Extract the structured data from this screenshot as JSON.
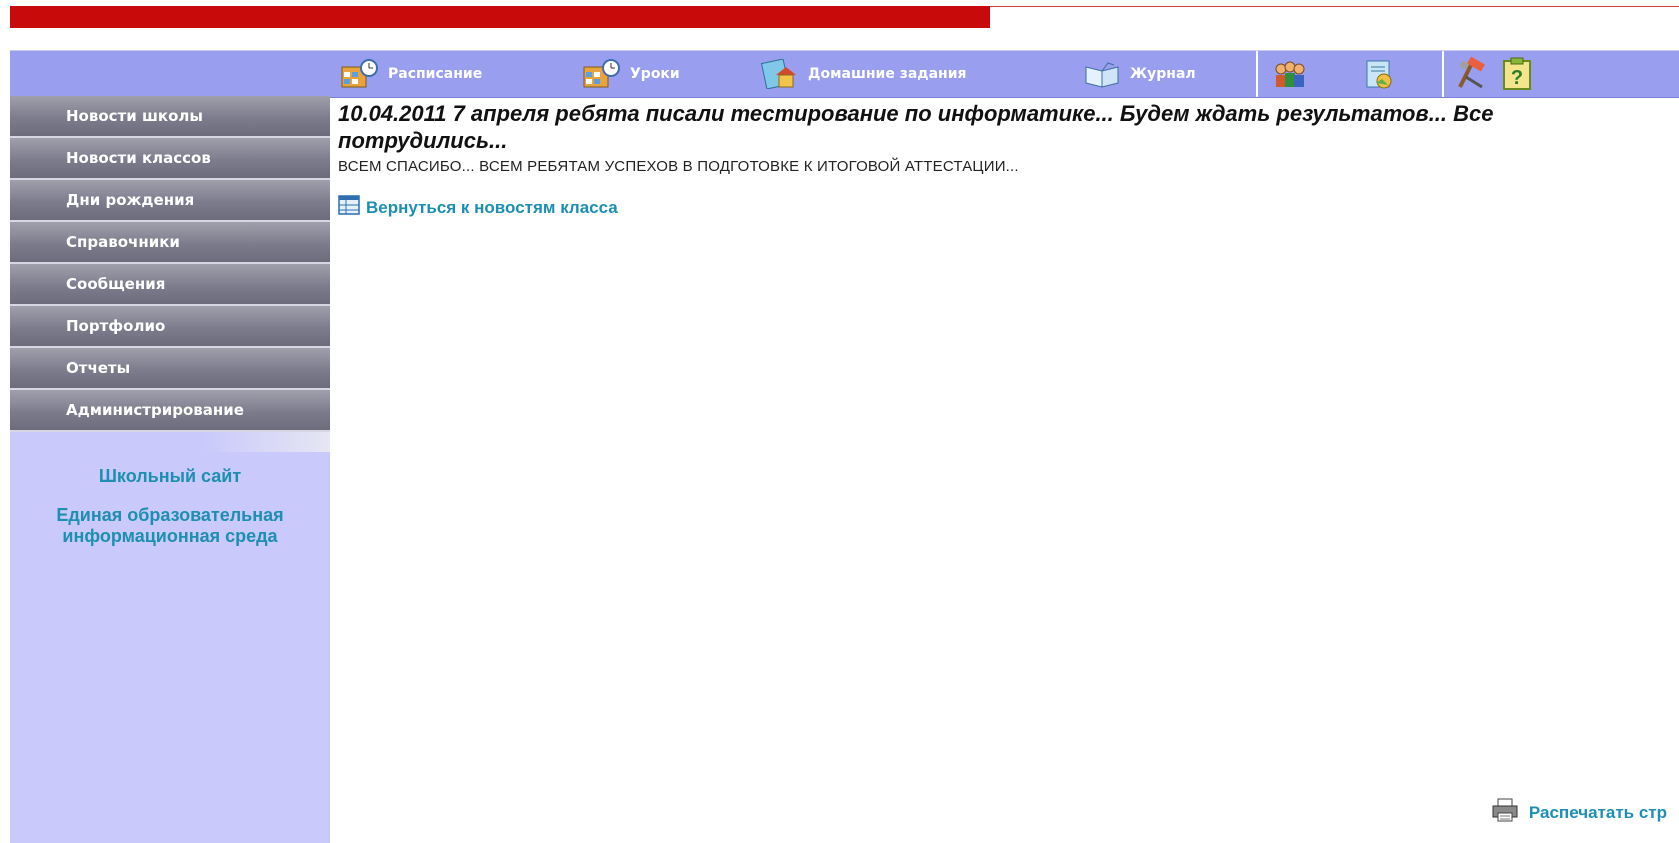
{
  "topnav": {
    "schedule_label": "Расписание",
    "lessons_label": "Уроки",
    "homework_label": "Домашние задания",
    "journal_label": "Журнал",
    "icons": [
      "people-icon",
      "certificate-icon",
      "tools-icon",
      "help-icon"
    ]
  },
  "sidebar": {
    "menu": [
      {
        "label": "Новости школы"
      },
      {
        "label": "Новости классов"
      },
      {
        "label": "Дни рождения"
      },
      {
        "label": "Справочники"
      },
      {
        "label": "Сообщения"
      },
      {
        "label": "Портфолио"
      },
      {
        "label": "Отчеты"
      },
      {
        "label": "Администрирование"
      }
    ],
    "school_site_link": "Школьный сайт",
    "unified_env_link_line1": "Единая образовательная",
    "unified_env_link_line2": "информационная среда"
  },
  "news": {
    "title": "10.04.2011 7 апреля ребята писали тестирование по информатике... Будем ждать результатов... Все потрудились...",
    "body": "ВСЕМ СПАСИБО... ВСЕМ РЕБЯТАМ УСПЕХОВ В ПОДГОТОВКЕ К ИТОГОВОЙ АТТЕСТАЦИИ...",
    "back_link": "Вернуться к новостям класса"
  },
  "footer": {
    "print_link": "Распечатать стр"
  },
  "colors": {
    "top_bar": "#c90a0a",
    "nav_bg": "#9a9eef",
    "sidebar_bg": "#c9c9fb",
    "link": "#1c8fb3"
  }
}
